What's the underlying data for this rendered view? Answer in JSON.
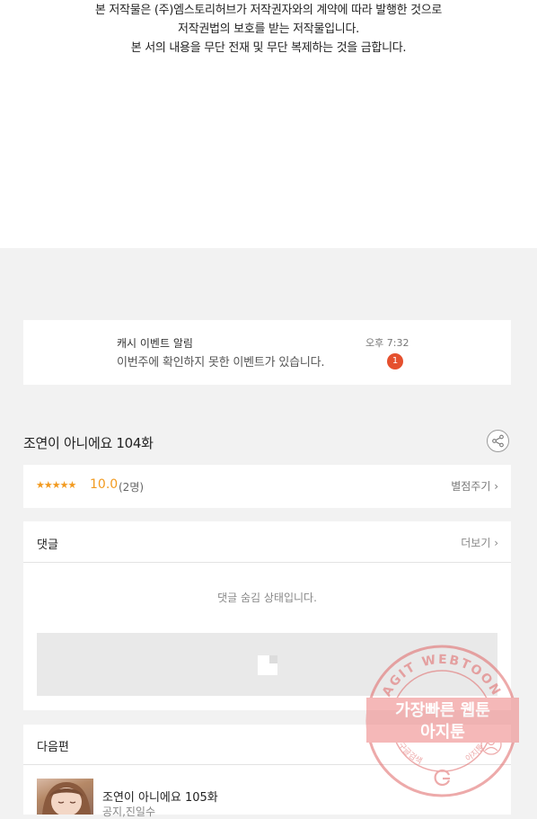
{
  "copyright": {
    "line1": "본 저작물은 (주)엠스토리허브가 저작권자와의 계약에 따라 발행한 것으로",
    "line2": "저작권법의 보호를 받는 저작물입니다.",
    "line3": "본 서의 내용을 무단 전재 및 무단 복제하는 것을 금합니다."
  },
  "notification": {
    "title": "캐시 이벤트 알림",
    "time": "오후 7:32",
    "message": "이번주에 확인하지 못한 이벤트가 있습니다.",
    "badge": "1"
  },
  "episode": {
    "title": "조연이 아니에요 104화",
    "share_icon": "share-icon"
  },
  "rating": {
    "stars": "★★★★★",
    "score": "10.0",
    "count": "(2명)",
    "rate_label": "별점주기 ›"
  },
  "comments": {
    "header": "댓글",
    "more_label": "더보기 ›",
    "hidden_message": "댓글 숨김 상태입니다."
  },
  "next_episode": {
    "header": "다음편",
    "title": "조연이 아니에요 105화",
    "author": "공지,진일수"
  },
  "watermark": {
    "ring_text": "AGIT WEBTOON",
    "line1": "가장빠른 웹툰",
    "line2": "아지툰",
    "bottom_left": "구글검색",
    "bottom_right": "아지툰"
  },
  "colors": {
    "accent_orange": "#f29a1f",
    "badge_red": "#e5502e",
    "stamp_red": "#e06565"
  }
}
